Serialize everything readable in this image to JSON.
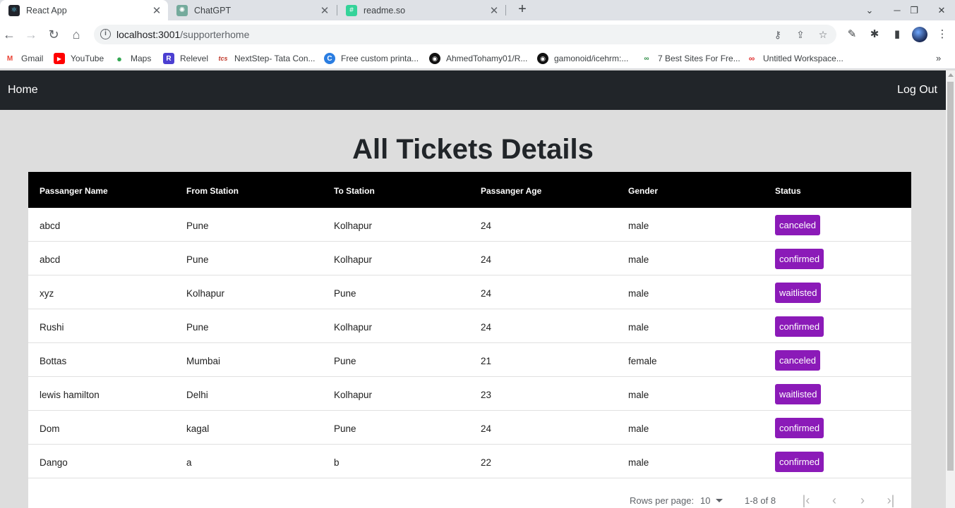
{
  "browser": {
    "tabs": [
      {
        "title": "React App",
        "icon": "react-icon",
        "active": true
      },
      {
        "title": "ChatGPT",
        "icon": "chatgpt-icon",
        "active": false
      },
      {
        "title": "readme.so",
        "icon": "readme-icon",
        "active": false
      }
    ],
    "url_host": "localhost:3001",
    "url_path": "/supporterhome",
    "bookmarks": [
      {
        "label": "Gmail",
        "icon": "M",
        "color": "#ea4335"
      },
      {
        "label": "YouTube",
        "icon": "▶",
        "color": "#ff0000"
      },
      {
        "label": "Maps",
        "icon": "📍",
        "color": "#34a853"
      },
      {
        "label": "Relevel",
        "icon": "R",
        "color": "#4b3fd1"
      },
      {
        "label": "NextStep- Tata Con...",
        "icon": "tcs",
        "color": "#c0392b"
      },
      {
        "label": "Free custom printa...",
        "icon": "C",
        "color": "#2a7de1"
      },
      {
        "label": "AhmedTohamy01/R...",
        "icon": "github-icon",
        "color": "#000000"
      },
      {
        "label": "gamonoid/icehrm:...",
        "icon": "github-icon",
        "color": "#000000"
      },
      {
        "label": "7 Best Sites For Fre...",
        "icon": "gfg-icon",
        "color": "#2f8d46"
      },
      {
        "label": "Untitled Workspace...",
        "icon": "link-icon",
        "color": "#e03030"
      }
    ]
  },
  "nav": {
    "home_label": "Home",
    "logout_label": "Log Out"
  },
  "page": {
    "title": "All Tickets Details"
  },
  "table": {
    "columns": [
      "Passanger Name",
      "From Station",
      "To Station",
      "Passanger Age",
      "Gender",
      "Status"
    ],
    "rows": [
      {
        "name": "abcd",
        "from": "Pune",
        "to": "Kolhapur",
        "age": "24",
        "gender": "male",
        "status": "canceled"
      },
      {
        "name": "abcd",
        "from": "Pune",
        "to": "Kolhapur",
        "age": "24",
        "gender": "male",
        "status": "confirmed"
      },
      {
        "name": "xyz",
        "from": "Kolhapur",
        "to": "Pune",
        "age": "24",
        "gender": "male",
        "status": "waitlisted"
      },
      {
        "name": "Rushi",
        "from": "Pune",
        "to": "Kolhapur",
        "age": "24",
        "gender": "male",
        "status": "confirmed"
      },
      {
        "name": "Bottas",
        "from": "Mumbai",
        "to": "Pune",
        "age": "21",
        "gender": "female",
        "status": "canceled"
      },
      {
        "name": "lewis hamilton",
        "from": "Delhi",
        "to": "Kolhapur",
        "age": "23",
        "gender": "male",
        "status": "waitlisted"
      },
      {
        "name": "Dom",
        "from": "kagal",
        "to": "Pune",
        "age": "24",
        "gender": "male",
        "status": "confirmed"
      },
      {
        "name": "Dango",
        "from": "a",
        "to": "b",
        "age": "22",
        "gender": "male",
        "status": "confirmed"
      }
    ],
    "status_color": "#8b1ab8"
  },
  "pagination": {
    "rows_per_page_label": "Rows per page:",
    "rows_per_page_value": "10",
    "range_text": "1-8 of 8"
  }
}
